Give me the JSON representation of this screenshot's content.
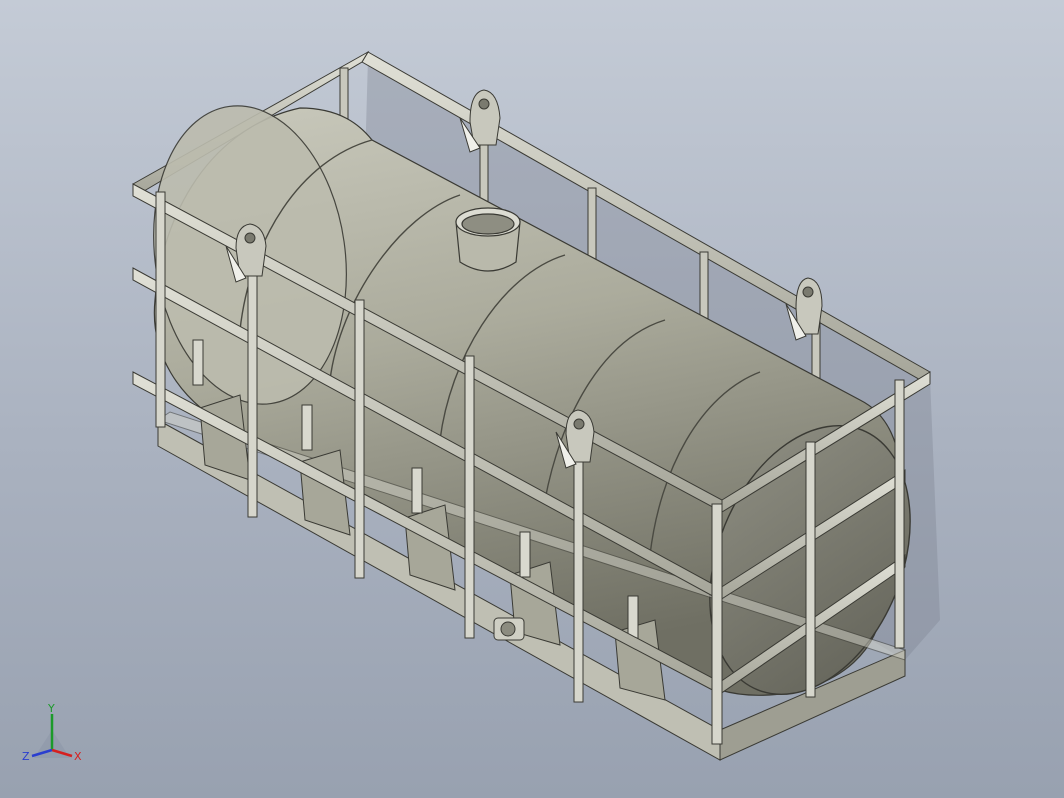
{
  "viewport": {
    "background_top": "#c4cbd6",
    "background_bottom": "#98a1b0",
    "model": {
      "body_color": "#a8a899",
      "frame_color": "#c8c8bd",
      "edge_color": "#3a3a34"
    }
  },
  "triad": {
    "x_label": "X",
    "y_label": "Y",
    "z_label": "Z",
    "x_color": "#d62020",
    "y_color": "#1c9a2a",
    "z_color": "#2a3ecf"
  }
}
